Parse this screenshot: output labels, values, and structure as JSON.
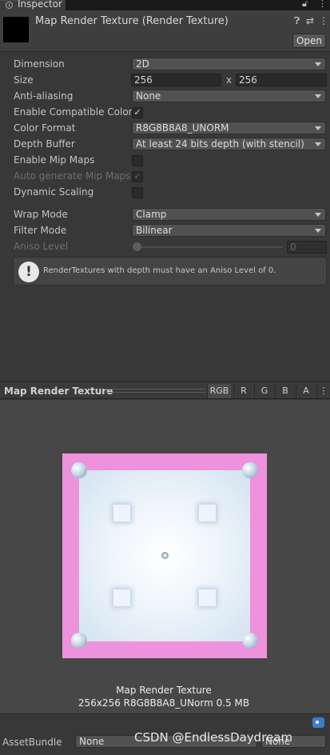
{
  "tab": {
    "label": "Inspector"
  },
  "header": {
    "title": "Map Render Texture (Render Texture)",
    "open_label": "Open"
  },
  "properties": {
    "dimension": {
      "label": "Dimension",
      "value": "2D"
    },
    "size": {
      "label": "Size",
      "width": "256",
      "x": "x",
      "height": "256"
    },
    "anti_aliasing": {
      "label": "Anti-aliasing",
      "value": "None"
    },
    "compat_color": {
      "label": "Enable Compatible Color F",
      "checked": "✓"
    },
    "color_format": {
      "label": "Color Format",
      "value": "R8G8B8A8_UNORM"
    },
    "depth_buffer": {
      "label": "Depth Buffer",
      "value": "At least 24 bits depth (with stencil)"
    },
    "mip_maps": {
      "label": "Enable Mip Maps"
    },
    "auto_mip": {
      "label": "Auto generate Mip Maps",
      "checked": "✓"
    },
    "dynamic_scaling": {
      "label": "Dynamic Scaling"
    },
    "wrap_mode": {
      "label": "Wrap Mode",
      "value": "Clamp"
    },
    "filter_mode": {
      "label": "Filter Mode",
      "value": "Bilinear"
    },
    "aniso": {
      "label": "Aniso Level",
      "value": "0"
    }
  },
  "help": {
    "icon": "!",
    "text": "RenderTextures with depth must have an Aniso Level of 0."
  },
  "preview": {
    "title": "Map Render Texture",
    "channels": [
      "RGB",
      "R",
      "G",
      "B",
      "A"
    ],
    "caption_name": "Map Render Texture",
    "caption_info": "256x256  R8G8B8A8_UNorm  0.5 MB"
  },
  "asset_bundle": {
    "label": "AssetBundle",
    "bundle": "None",
    "variant": "None"
  },
  "watermark": "CSDN @EndlessDaydream",
  "icons": {
    "tab": "info-icon",
    "lock": "lock-icon",
    "menu": "kebab-menu-icon",
    "help": "help-icon",
    "preset": "preset-icon",
    "tag": "tag-icon"
  },
  "colors": {
    "texture_border": "#ee92dd",
    "texture_fill": "#eef5fb",
    "panel_bg": "#383838"
  }
}
